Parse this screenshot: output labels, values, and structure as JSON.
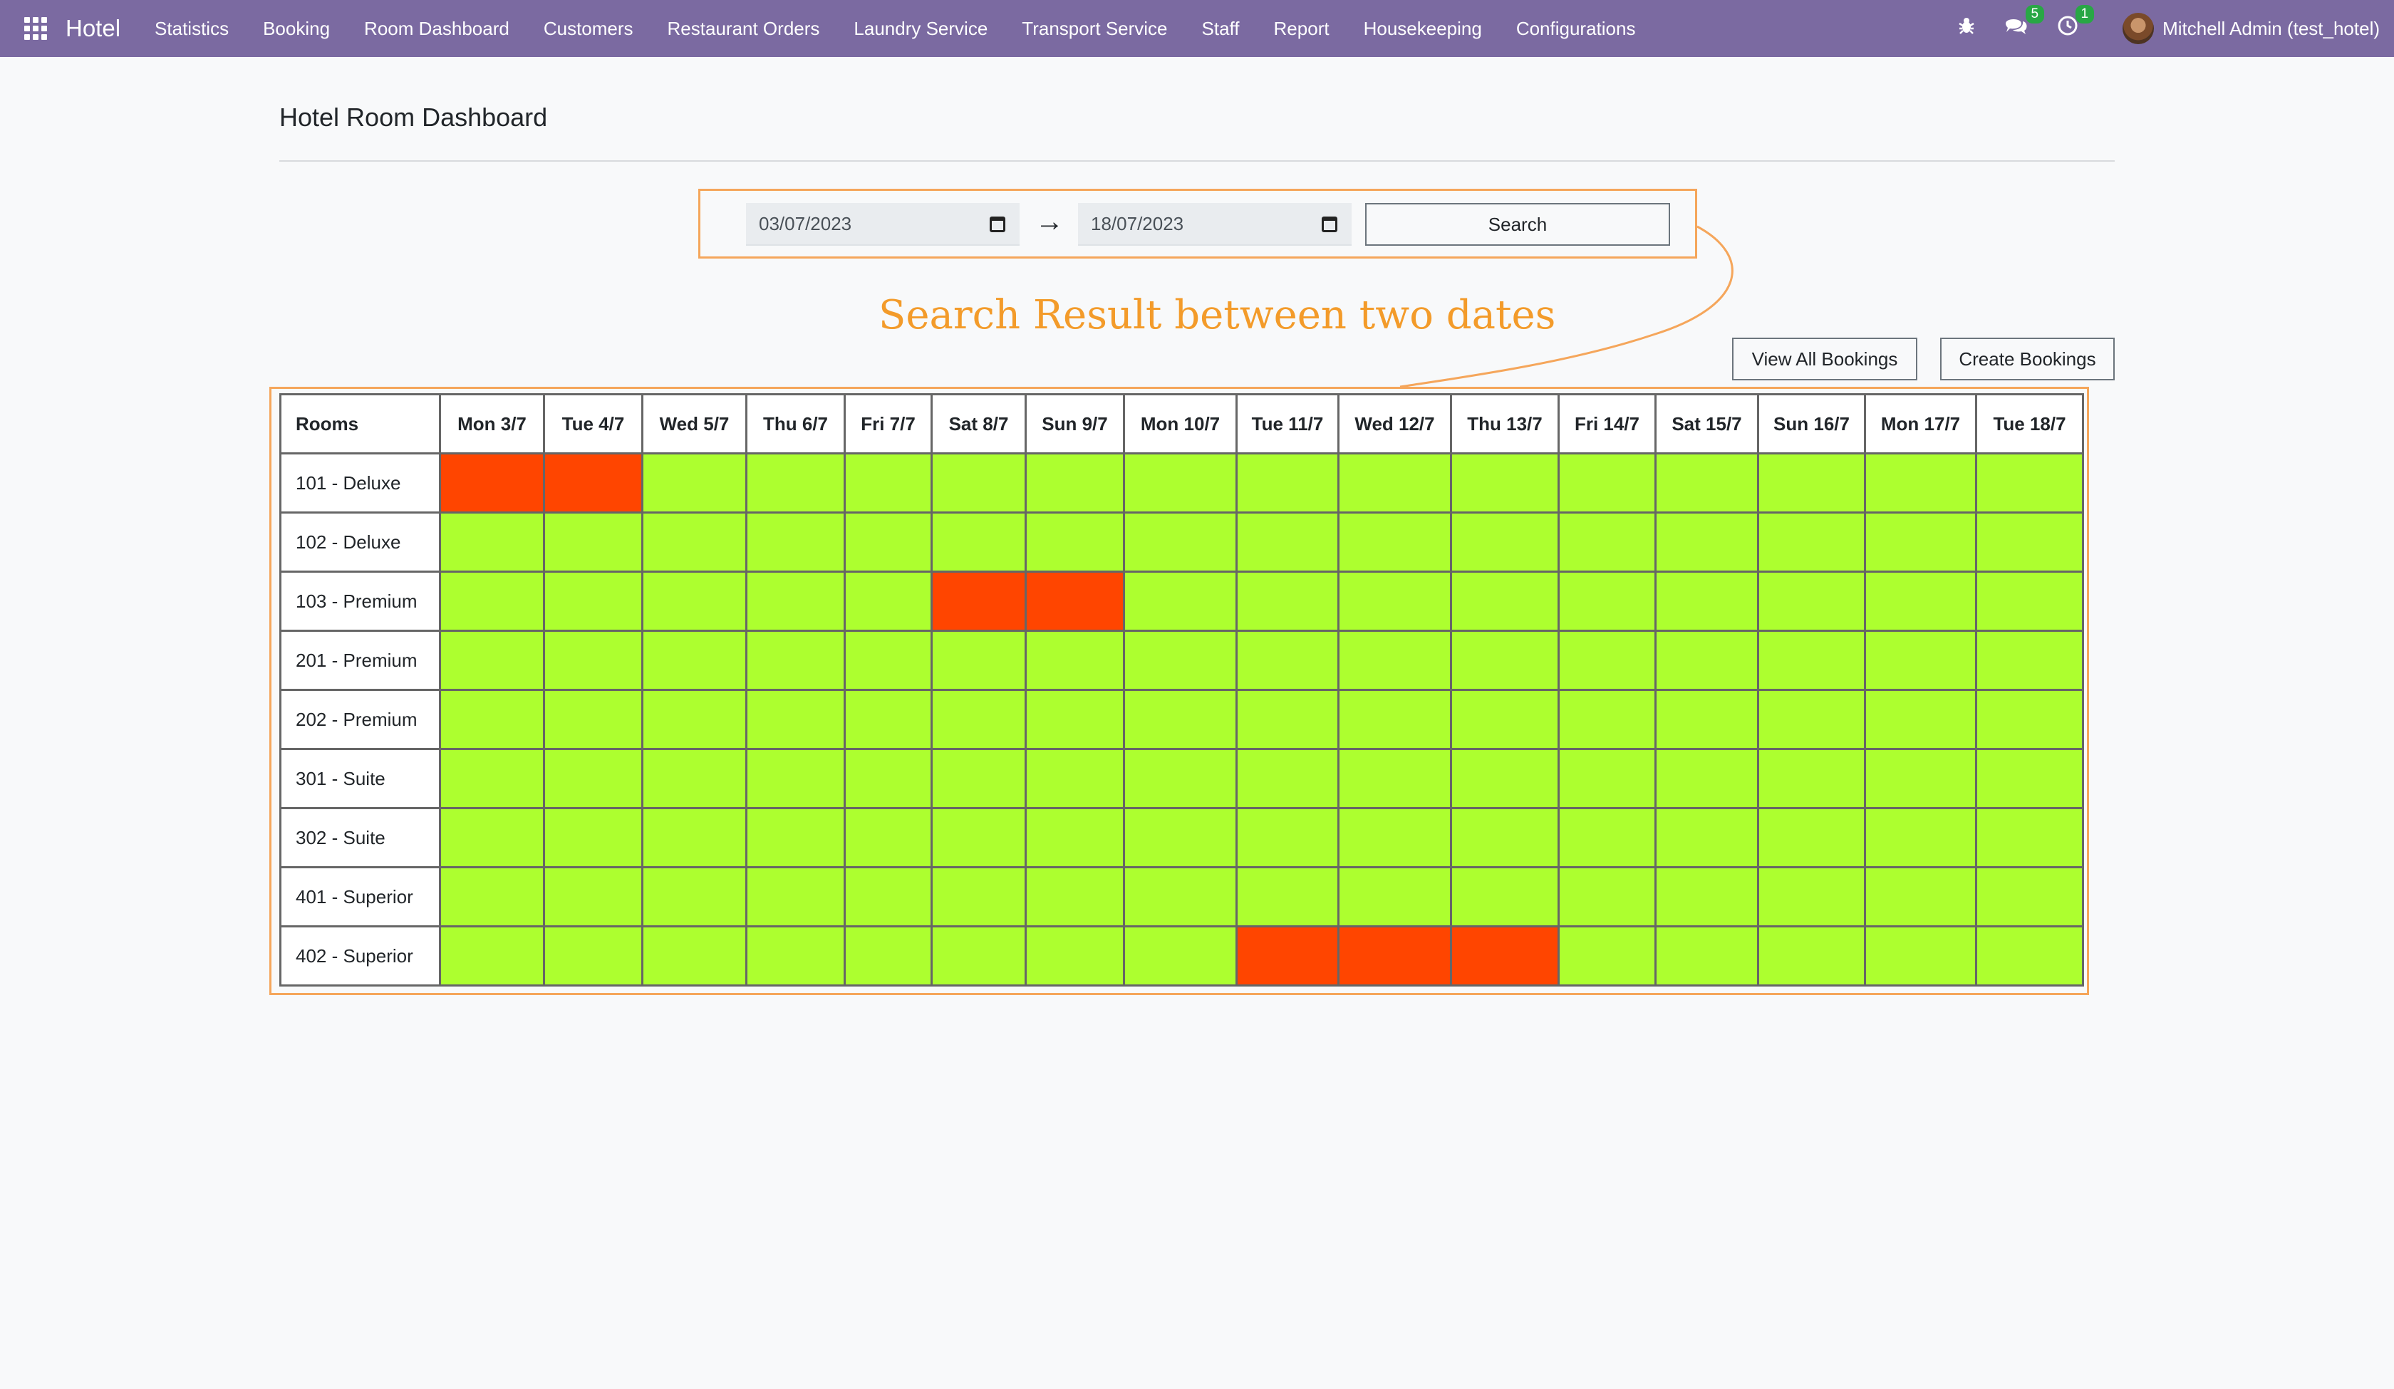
{
  "app": {
    "brand": "Hotel",
    "menu": [
      "Statistics",
      "Booking",
      "Room Dashboard",
      "Customers",
      "Restaurant Orders",
      "Laundry Service",
      "Transport Service",
      "Staff",
      "Report",
      "Housekeeping",
      "Configurations"
    ],
    "messages_count": "5",
    "activities_count": "1",
    "user": "Mitchell Admin (test_hotel)"
  },
  "page": {
    "title": "Hotel Room Dashboard"
  },
  "search": {
    "date_from": "03/07/2023",
    "date_to": "18/07/2023",
    "button_label": "Search"
  },
  "annotation": "Search Result between two dates",
  "actions": {
    "view_all": "View All Bookings",
    "create": "Create Bookings"
  },
  "colors": {
    "available": "#adff2f",
    "booked": "#ff4500",
    "highlight": "#f5a65b",
    "navbar": "#7b6aa1"
  },
  "table": {
    "rooms_header": "Rooms",
    "days": [
      "Mon 3/7",
      "Tue 4/7",
      "Wed 5/7",
      "Thu 6/7",
      "Fri 7/7",
      "Sat 8/7",
      "Sun 9/7",
      "Mon 10/7",
      "Tue 11/7",
      "Wed 12/7",
      "Thu 13/7",
      "Fri 14/7",
      "Sat 15/7",
      "Sun 16/7",
      "Mon 17/7",
      "Tue 18/7"
    ],
    "rooms": [
      {
        "name": "101 - Deluxe",
        "booked": [
          0,
          1
        ]
      },
      {
        "name": "102 - Deluxe",
        "booked": []
      },
      {
        "name": "103 - Premium",
        "booked": [
          5,
          6
        ]
      },
      {
        "name": "201 - Premium",
        "booked": []
      },
      {
        "name": "202 - Premium",
        "booked": []
      },
      {
        "name": "301 - Suite",
        "booked": []
      },
      {
        "name": "302 - Suite",
        "booked": []
      },
      {
        "name": "401 - Superior",
        "booked": []
      },
      {
        "name": "402 - Superior",
        "booked": [
          8,
          9,
          10
        ]
      }
    ]
  }
}
